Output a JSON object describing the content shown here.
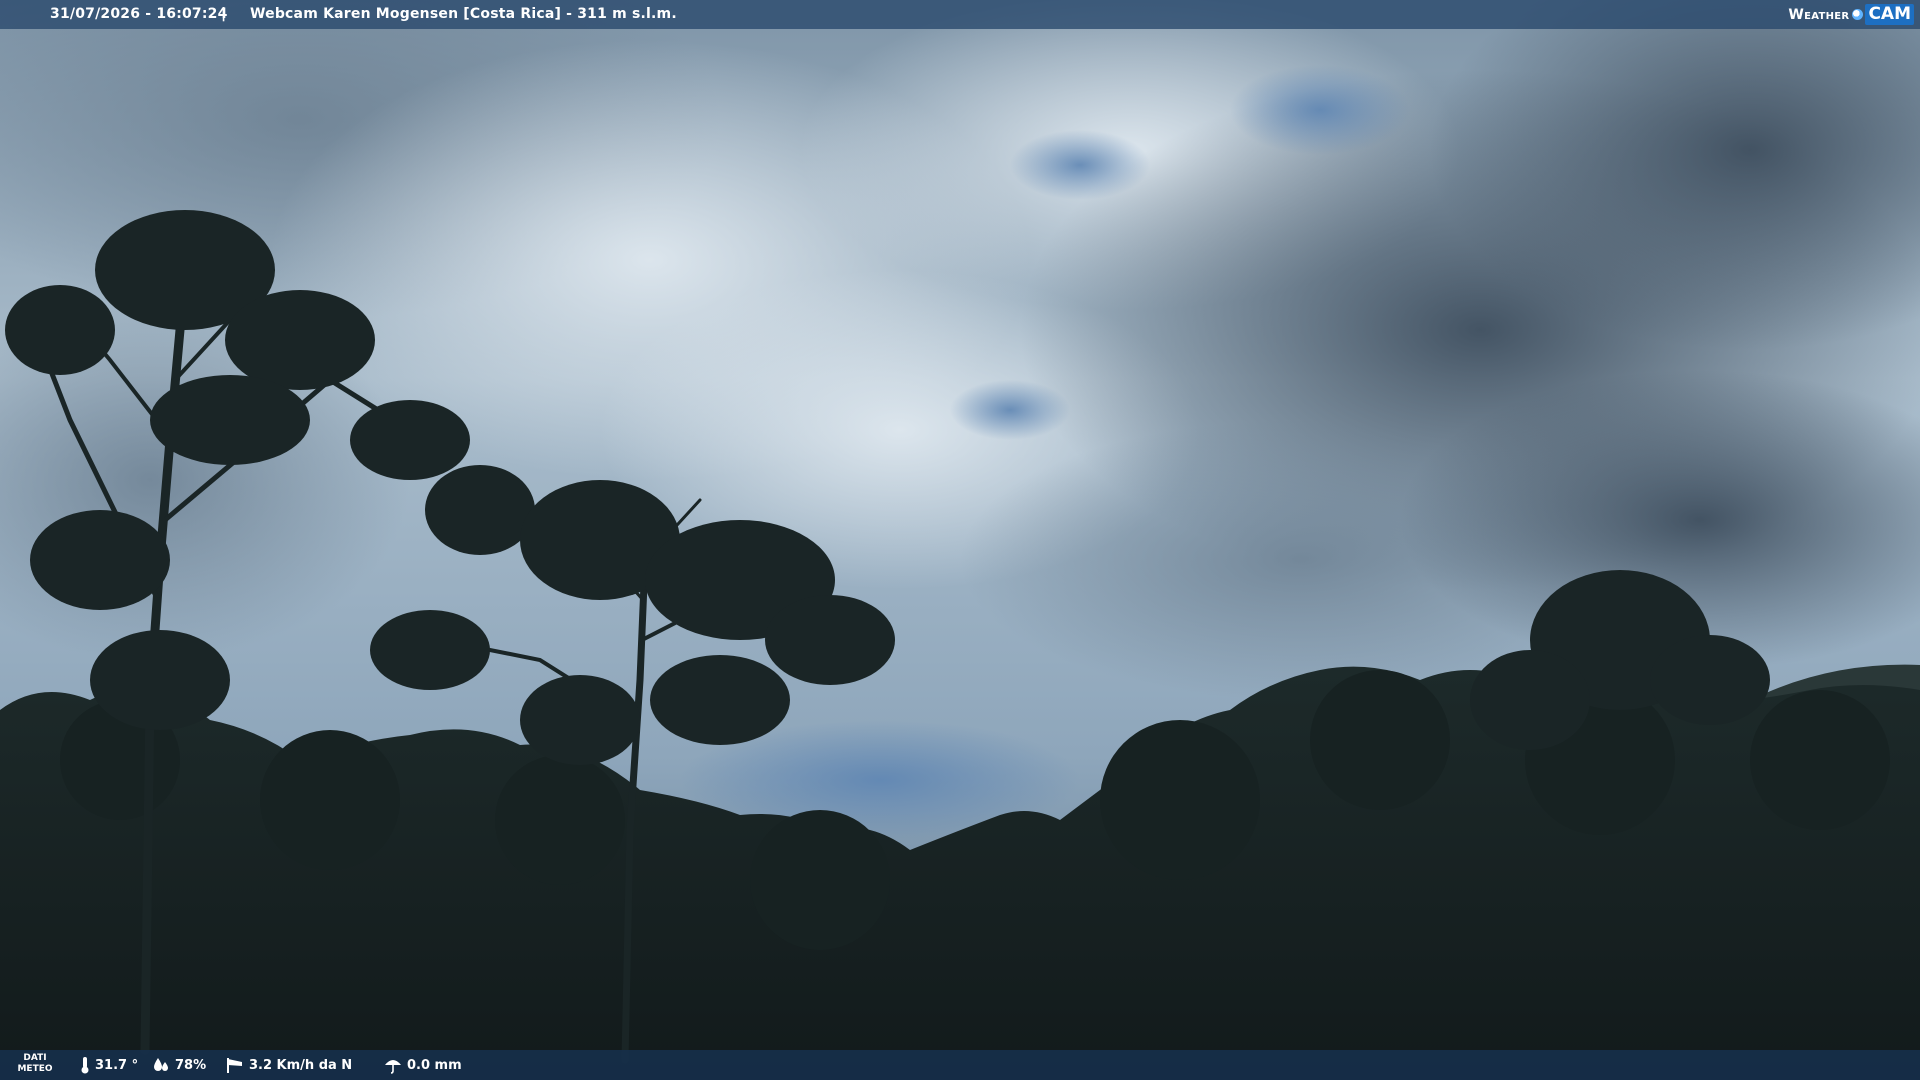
{
  "overlay": {
    "timestamp": "31/07/2026 - 16:07:24",
    "separator": "|",
    "station": "Webcam Karen Mogensen [Costa Rica]  - 311 m s.l.m.",
    "brand_weather": "Weather",
    "brand_cam": "CAM"
  },
  "weather": {
    "dati_line1": "DATI",
    "dati_line2": "METEO",
    "temperature": "31.7 °",
    "humidity": "78%",
    "wind": "3.2 Km/h da N",
    "rain": "0.0 mm"
  },
  "icons": {
    "temperature": "thermometer-icon",
    "humidity": "humidity-drops-icon",
    "wind": "windsock-icon",
    "rain": "rain-umbrella-icon"
  },
  "colors": {
    "top_bar": "#28486c",
    "bottom_bar": "#16304e",
    "brand_accent": "#1d6fc2"
  }
}
